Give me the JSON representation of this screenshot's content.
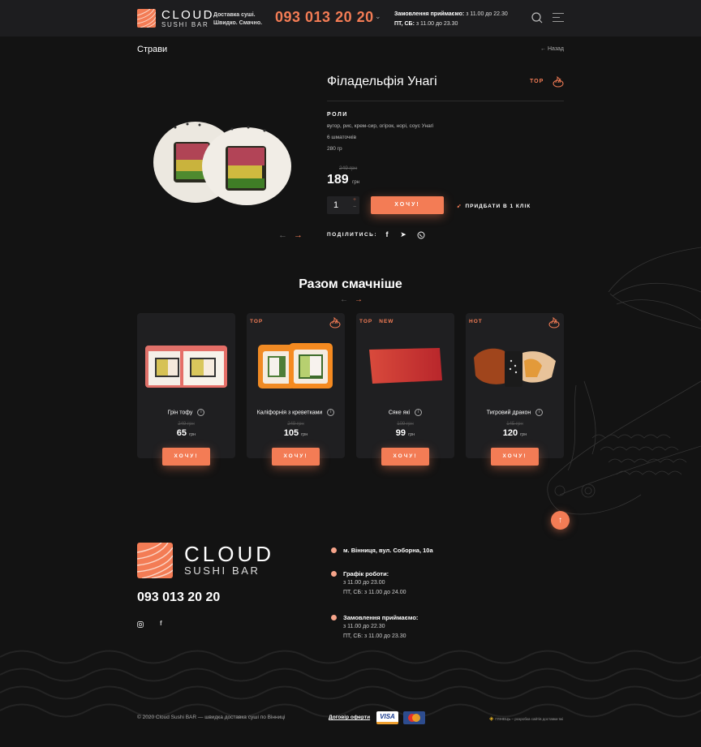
{
  "header": {
    "logo_line1": "CLOUD",
    "logo_line2": "SUSHI BAR",
    "tagline_line1": "Доставка суші.",
    "tagline_line2": "Швидко. Смачно.",
    "phone": "093 013 20 20",
    "hours_label": "Замовлення приймаємо:",
    "hours_weekday": "з 11.00 до 22.30",
    "hours_weekend_label": "ПТ, СБ:",
    "hours_weekend": "з 11.00 до 23.30",
    "icons": [
      "search-icon",
      "menu-icon",
      "chevron-down-icon"
    ]
  },
  "breadcrumb": {
    "title": "Страви",
    "back_label": "← Назад"
  },
  "product": {
    "name": "Філадельфія Унагі",
    "badge": "TOP",
    "badge_icon": "spicy-flame-icon",
    "category": "РОЛИ",
    "ingredients": "вугор, рис, крем-сир, огірок, норі, соус Унагі",
    "pieces": "6 шматочків",
    "weight": "280 гр",
    "old_price": "249 грн",
    "price": "189",
    "currency": "грн",
    "quantity": "1",
    "buy_label": "ХОЧУ!",
    "one_click_label": "ПРИДБАТИ В 1 КЛІК",
    "share_label": "ПОДІЛИТИСЬ:",
    "share_icons": [
      "facebook-icon",
      "telegram-icon",
      "viber-icon"
    ]
  },
  "related": {
    "title": "Разом смачніше",
    "items": [
      {
        "name": "Грін тофу",
        "badges": [],
        "flame": false,
        "old_price": "249 грн",
        "price": "65",
        "currency": "грн",
        "button": "ХОЧУ!"
      },
      {
        "name": "Каліфорнія з креветками",
        "badges": [
          "TOP"
        ],
        "flame": true,
        "old_price": "249 грн",
        "price": "105",
        "currency": "грн",
        "button": "ХОЧУ!"
      },
      {
        "name": "Сяке які",
        "badges": [
          "TOP",
          "NEW"
        ],
        "flame": false,
        "old_price": "109 грн",
        "price": "99",
        "currency": "грн",
        "button": "ХОЧУ!"
      },
      {
        "name": "Тигровий дракон",
        "badges": [
          "HOT"
        ],
        "flame": true,
        "old_price": "145 грн",
        "price": "120",
        "currency": "грн",
        "button": "ХОЧУ!"
      }
    ]
  },
  "footer": {
    "logo_line1": "CLOUD",
    "logo_line2": "SUSHI BAR",
    "phone": "093 013 20 20",
    "social_icons": [
      "instagram-icon",
      "facebook-icon"
    ],
    "address": "м. Вінниця, вул. Соборна, 10а",
    "schedule_title": "Графік роботи:",
    "schedule_weekday": "з 11.00 до 23.00",
    "schedule_weekend": "ПТ, СБ: з 11.00 до 24.00",
    "orders_title": "Замовлення приймаємо:",
    "orders_weekday": "з 11.00 до 22.30",
    "orders_weekend": "ПТ, СБ: з 11.00 до 23.30",
    "copyright": "© 2020 Cloud Sushi BAR  — швидка доставка суші по Вінниці",
    "offer_link": "Договір оферти",
    "visa": "VISA",
    "developer": "ГЛІНЕЦЬ – розробка сайтів доставки їжі"
  },
  "colors": {
    "accent": "#f37c55",
    "background": "#131313",
    "header_bg": "#1d1d1f",
    "card_bg": "#1f1f21"
  }
}
